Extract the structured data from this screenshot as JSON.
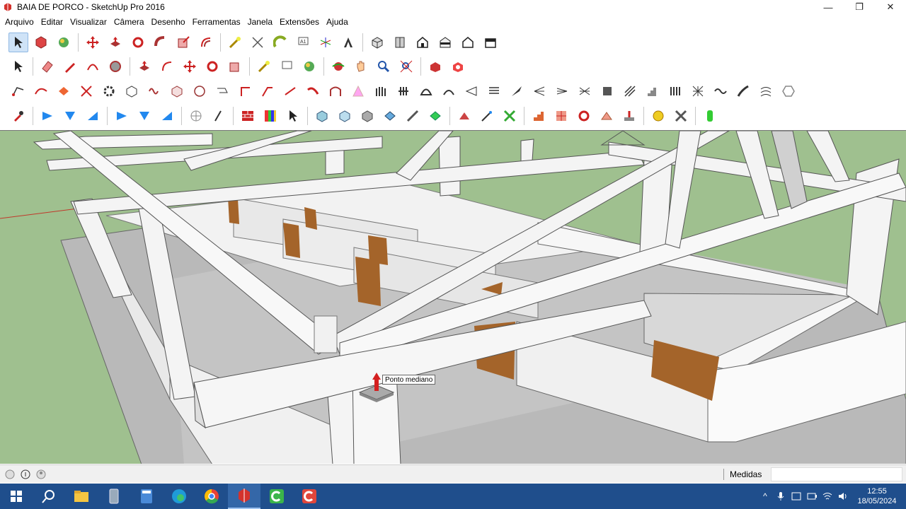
{
  "window": {
    "title": "BAIA DE PORCO - SketchUp Pro 2016",
    "minimize": "—",
    "restore": "❐",
    "close": "✕"
  },
  "menu": [
    "Arquivo",
    "Editar",
    "Visualizar",
    "Câmera",
    "Desenho",
    "Ferramentas",
    "Janela",
    "Extensões",
    "Ajuda"
  ],
  "viewport": {
    "tooltip": "Ponto mediano",
    "colors": {
      "sky_ground": "#9fc08f",
      "wood": "#a4642a",
      "white": "#f4f4f4",
      "grey": "#bdbdbd"
    }
  },
  "statusbar": {
    "measure_label": "Medidas",
    "measure_value": ""
  },
  "taskbar": {
    "time": "12:55",
    "date": "18/05/2024",
    "apps": [
      "start-icon",
      "search-icon",
      "file-explorer-icon",
      "phone-link-icon",
      "calculator-icon",
      "edge-icon",
      "chrome-icon",
      "sketchup-icon",
      "camtasia-recorder-icon",
      "camtasia-icon"
    ]
  }
}
